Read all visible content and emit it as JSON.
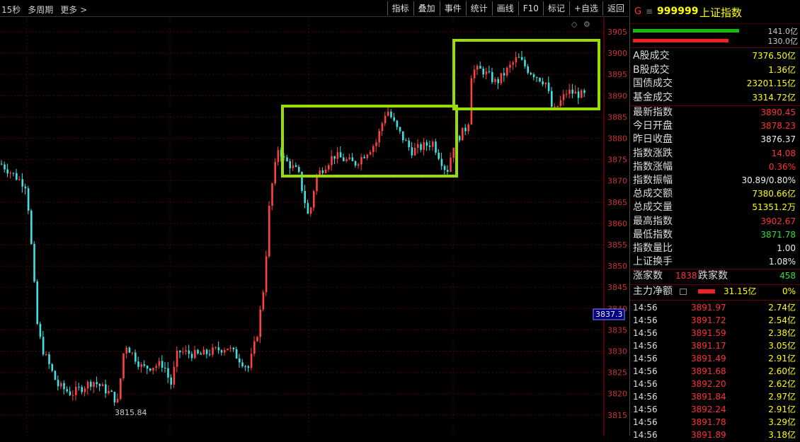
{
  "toolbar": {
    "period": "15秒",
    "multi_period": "多周期",
    "more": "更多 >",
    "buttons": [
      "指标",
      "叠加",
      "事件",
      "统计",
      "画线",
      "F10",
      "标记",
      "+自选",
      "返回"
    ]
  },
  "chart": {
    "price_axis": [
      "3905",
      "3900",
      "3895",
      "3890",
      "3885",
      "3880",
      "3875",
      "3870",
      "3865",
      "3860",
      "3855",
      "3850",
      "3845",
      "3840",
      "3835",
      "3830",
      "3825",
      "3820",
      "3815"
    ],
    "cursor_price": "3837.3",
    "low_label": "3815.84",
    "colors": {
      "up": "#ff4040",
      "down": "#40e0e0",
      "highlight": "#99dd00"
    }
  },
  "panel": {
    "code_prefix": "G",
    "menu_icon": "≡",
    "code": "999999",
    "name": "上证指数",
    "bar1_value": "141.0亿",
    "bar2_value": "130.0亿",
    "turnover": [
      {
        "label": "A股成交",
        "value": "7376.50亿"
      },
      {
        "label": "B股成交",
        "value": "1.36亿"
      },
      {
        "label": "国债成交",
        "value": "23201.15亿"
      },
      {
        "label": "基金成交",
        "value": "3314.72亿"
      }
    ],
    "stats": [
      {
        "label": "最新指数",
        "value": "3890.45",
        "color": "red"
      },
      {
        "label": "今日开盘",
        "value": "3878.23",
        "color": "red"
      },
      {
        "label": "昨日收盘",
        "value": "3876.37",
        "color": "white"
      },
      {
        "label": "指数涨跌",
        "value": "14.08",
        "color": "red"
      },
      {
        "label": "指数涨幅",
        "value": "0.36%",
        "color": "red"
      },
      {
        "label": "指数振幅",
        "value": "30.89/0.80%",
        "color": "white"
      },
      {
        "label": "总成交额",
        "value": "7380.66亿",
        "color": "yellow"
      },
      {
        "label": "总成交量",
        "value": "51351.2万",
        "color": "yellow"
      },
      {
        "label": "最高指数",
        "value": "3902.67",
        "color": "red"
      },
      {
        "label": "最低指数",
        "value": "3871.78",
        "color": "green"
      },
      {
        "label": "指数量比",
        "value": "1.00",
        "color": "white"
      },
      {
        "label": "上证换手",
        "value": "1.08%",
        "color": "white"
      }
    ],
    "rise_label": "涨家数",
    "rise_count": "1838",
    "fall_label": "跌家数",
    "fall_count": "458",
    "main_label": "主力净额",
    "main_value": "31.15亿",
    "main_pct": "0%",
    "ticks": [
      {
        "time": "14:56",
        "price": "3891.97",
        "amount": "2.74亿"
      },
      {
        "time": "14:56",
        "price": "3891.72",
        "amount": "2.54亿"
      },
      {
        "time": "14:56",
        "price": "3891.59",
        "amount": "2.38亿"
      },
      {
        "time": "14:56",
        "price": "3891.17",
        "amount": "3.05亿"
      },
      {
        "time": "14:56",
        "price": "3891.49",
        "amount": "2.91亿"
      },
      {
        "time": "14:56",
        "price": "3891.68",
        "amount": "2.60亿"
      },
      {
        "time": "14:56",
        "price": "3892.20",
        "amount": "2.62亿"
      },
      {
        "time": "14:56",
        "price": "3891.84",
        "amount": "2.97亿"
      },
      {
        "time": "14:56",
        "price": "3892.24",
        "amount": "2.91亿"
      },
      {
        "time": "14:56",
        "price": "3891.78",
        "amount": "3.29亿"
      },
      {
        "time": "14:56",
        "price": "3891.89",
        "amount": "3.18亿"
      }
    ]
  }
}
